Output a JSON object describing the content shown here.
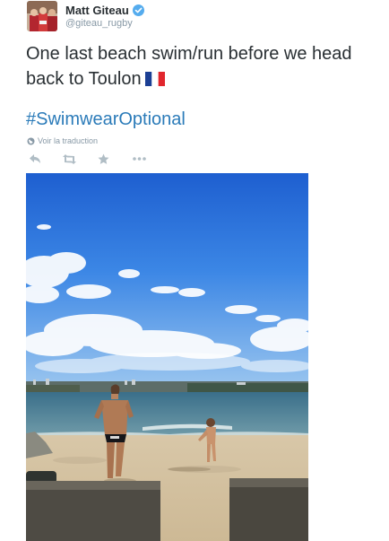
{
  "author": {
    "display_name": "Matt Giteau",
    "handle": "@giteau_rugby"
  },
  "tweet": {
    "text": "One last beach swim/run before we head back to Toulon",
    "hashtag": "#SwimwearOptional"
  },
  "translate_link": "Voir la traduction",
  "icons": {
    "avatar": "profile-photo",
    "verified": "verified-badge-icon",
    "flag": "france-flag-icon",
    "translate": "globe-icon",
    "reply": "reply-icon",
    "retweet": "retweet-icon",
    "favorite": "star-icon",
    "more": "more-dots-icon"
  },
  "colors": {
    "link": "#2b7bb9",
    "verified": "#55acee",
    "muted": "#8899a6",
    "action": "#b0bdc5"
  }
}
